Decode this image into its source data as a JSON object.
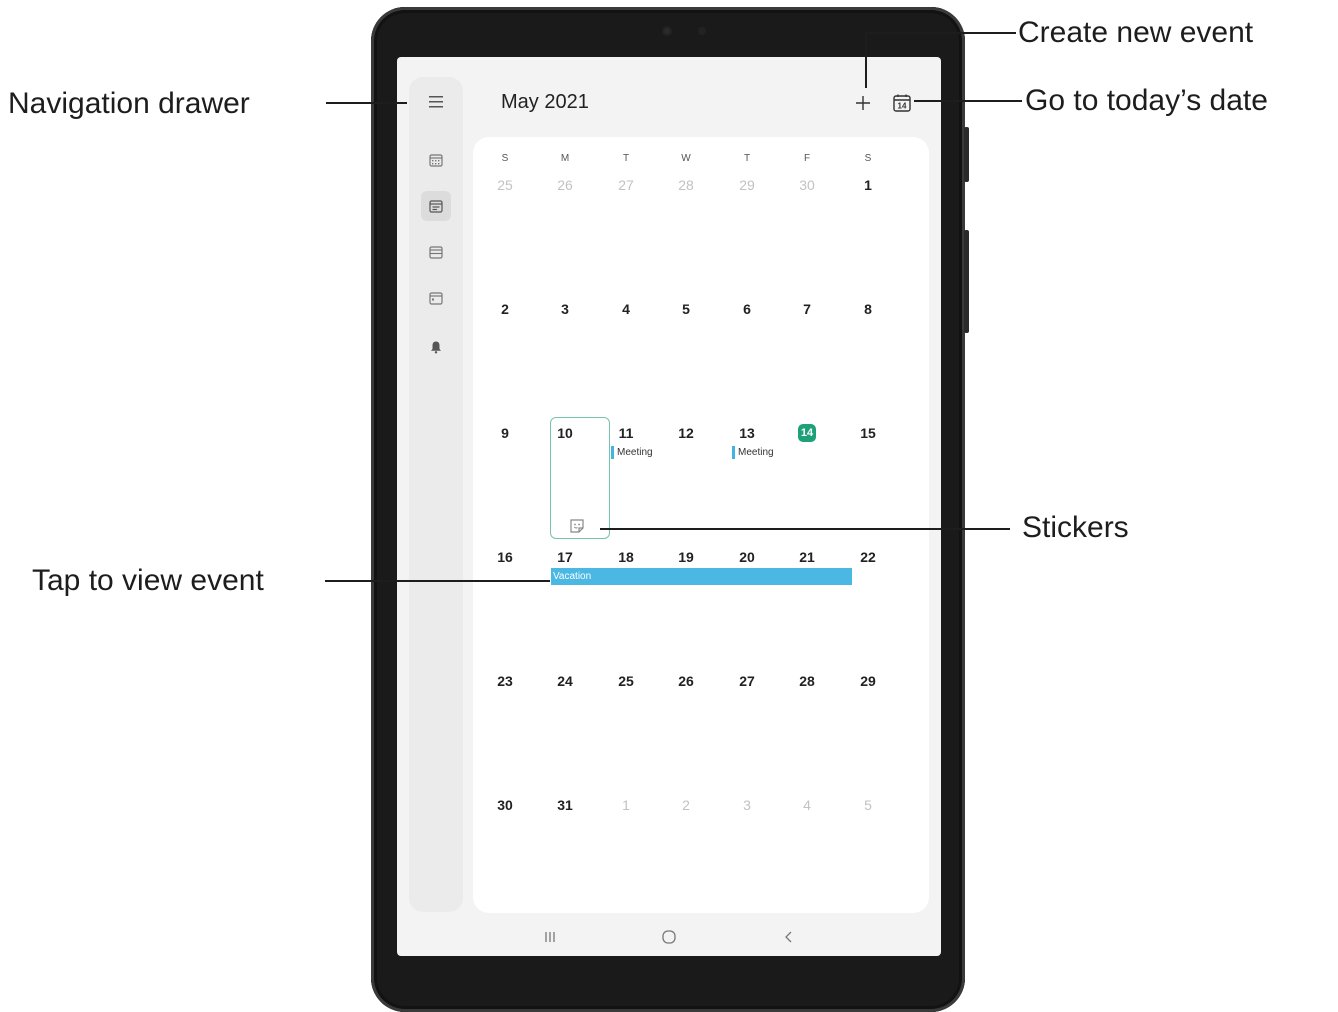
{
  "screen": {
    "month_title": "May 2021",
    "weekdays": [
      "S",
      "M",
      "T",
      "W",
      "T",
      "F",
      "S"
    ],
    "weeks": [
      [
        {
          "d": "25",
          "muted": true
        },
        {
          "d": "26",
          "muted": true
        },
        {
          "d": "27",
          "muted": true
        },
        {
          "d": "28",
          "muted": true
        },
        {
          "d": "29",
          "muted": true
        },
        {
          "d": "30",
          "muted": true
        },
        {
          "d": "1",
          "muted": false
        }
      ],
      [
        {
          "d": "2",
          "muted": false
        },
        {
          "d": "3",
          "muted": false
        },
        {
          "d": "4",
          "muted": false
        },
        {
          "d": "5",
          "muted": false
        },
        {
          "d": "6",
          "muted": false
        },
        {
          "d": "7",
          "muted": false
        },
        {
          "d": "8",
          "muted": false
        }
      ],
      [
        {
          "d": "9",
          "muted": false
        },
        {
          "d": "10",
          "muted": false
        },
        {
          "d": "11",
          "muted": false
        },
        {
          "d": "12",
          "muted": false
        },
        {
          "d": "13",
          "muted": false
        },
        {
          "d": "14",
          "muted": false,
          "today": true
        },
        {
          "d": "15",
          "muted": false
        }
      ],
      [
        {
          "d": "16",
          "muted": false
        },
        {
          "d": "17",
          "muted": false
        },
        {
          "d": "18",
          "muted": false
        },
        {
          "d": "19",
          "muted": false
        },
        {
          "d": "20",
          "muted": false
        },
        {
          "d": "21",
          "muted": false
        },
        {
          "d": "22",
          "muted": false
        }
      ],
      [
        {
          "d": "23",
          "muted": false
        },
        {
          "d": "24",
          "muted": false
        },
        {
          "d": "25",
          "muted": false
        },
        {
          "d": "26",
          "muted": false
        },
        {
          "d": "27",
          "muted": false
        },
        {
          "d": "28",
          "muted": false
        },
        {
          "d": "29",
          "muted": false
        }
      ],
      [
        {
          "d": "30",
          "muted": false
        },
        {
          "d": "31",
          "muted": false
        },
        {
          "d": "1",
          "muted": true
        },
        {
          "d": "2",
          "muted": true
        },
        {
          "d": "3",
          "muted": true
        },
        {
          "d": "4",
          "muted": true
        },
        {
          "d": "5",
          "muted": true
        }
      ]
    ],
    "events": {
      "meeting_11": "Meeting",
      "meeting_13": "Meeting",
      "vacation": "Vacation"
    },
    "today_icon_number": "14",
    "rail_icons": [
      "year-view-icon",
      "month-view-icon",
      "week-view-icon",
      "day-view-icon",
      "notifications-bell-icon"
    ],
    "colors": {
      "today_accent": "#1ea179",
      "event_blue": "#4ab8e3",
      "selected_outline": "#74c4ad"
    }
  },
  "callouts": {
    "navigation_drawer": "Navigation drawer",
    "create_new_event": "Create new event",
    "go_to_today": "Go to today’s date",
    "stickers": "Stickers",
    "tap_to_view_event": "Tap to view event"
  }
}
